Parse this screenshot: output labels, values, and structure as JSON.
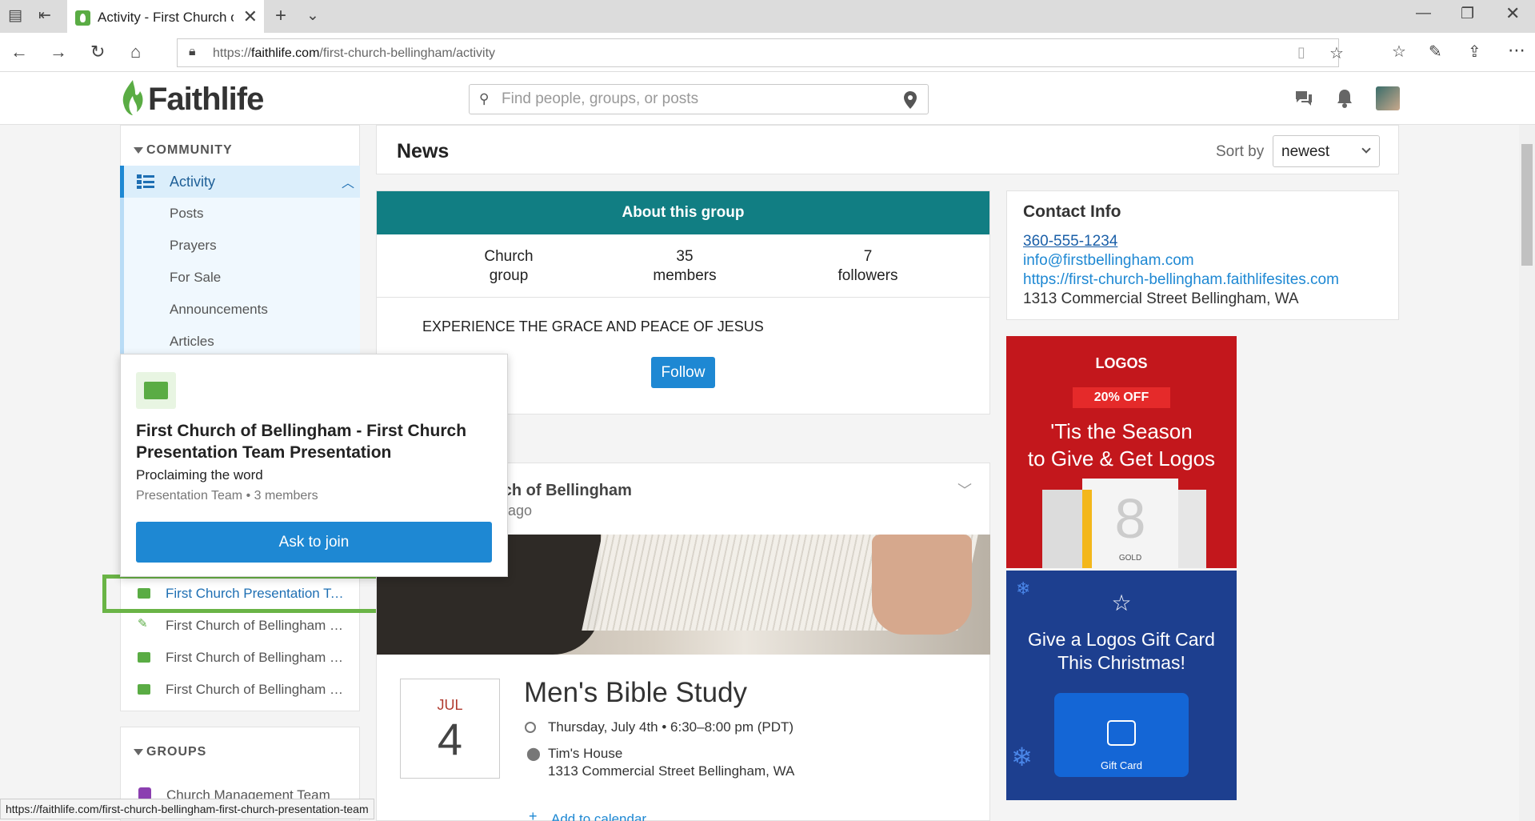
{
  "browser": {
    "tab_title": "Activity - First Church o",
    "url_prefix": "https://",
    "url_host": "faithlife.com",
    "url_path": "/first-church-bellingham/activity",
    "status_url": "https://faithlife.com/first-church-bellingham-first-church-presentation-team"
  },
  "site": {
    "brand": "Faithlife",
    "search_placeholder": "Find people, groups, or posts"
  },
  "sidebar": {
    "community_heading": "COMMUNITY",
    "activity_label": "Activity",
    "sub_items": [
      "Posts",
      "Prayers",
      "For Sale",
      "Announcements",
      "Articles"
    ],
    "groups_list": [
      "First Church Presentation Team",
      "First Church of Bellingham W...",
      "First Church of Bellingham Pr...",
      "First Church of Bellingham Pr..."
    ],
    "groups_heading": "GROUPS",
    "groups_first": "Church Management Team"
  },
  "popup": {
    "name": "First Church of Bellingham - First Church Presentation Team Presentation",
    "description": "Proclaiming the word",
    "meta": "Presentation Team • 3 members",
    "join_label": "Ask to join"
  },
  "main": {
    "news_title": "News",
    "sort_label": "Sort by",
    "sort_value": "newest",
    "about": {
      "bar": "About this group",
      "stat1_top": "Church",
      "stat1_bottom": "group",
      "stat2_top": "35",
      "stat2_bottom": "members",
      "stat3_top": "7",
      "stat3_bottom": "followers",
      "motto": "EXPERIENCE THE GRACE AND PEACE OF JESUS",
      "follow_label": "Follow"
    },
    "post": {
      "author": "rch of Bellingham",
      "time": "s ago",
      "month": "JUL",
      "day": "4",
      "title": "Men's Bible Study",
      "when": "Thursday, July 4th • 6:30–8:00 pm (PDT)",
      "place_name": "Tim's House",
      "place_address": "1313 Commercial Street Bellingham, WA",
      "add_calendar": "Add to calendar"
    }
  },
  "contact": {
    "heading": "Contact Info",
    "phone": "360-555-1234",
    "email": "info@firstbellingham.com",
    "website": "https://first-church-bellingham.faithlifesites.com",
    "address": "1313 Commercial Street Bellingham, WA"
  },
  "ads": {
    "ad1_brand": "LOGOS",
    "ad1_off": "20% OFF",
    "ad1_line1": "'Tis the Season",
    "ad1_line2": "to Give & Get Logos",
    "ad1_tier": "GOLD",
    "ad2_line1": "Give a Logos Gift Card",
    "ad2_line2": "This Christmas!",
    "ad2_card": "Gift Card"
  },
  "colors": {
    "accent": "#1e88d3",
    "brand_green": "#5aac44",
    "teal": "#117e83",
    "highlight": "#6ab446"
  }
}
